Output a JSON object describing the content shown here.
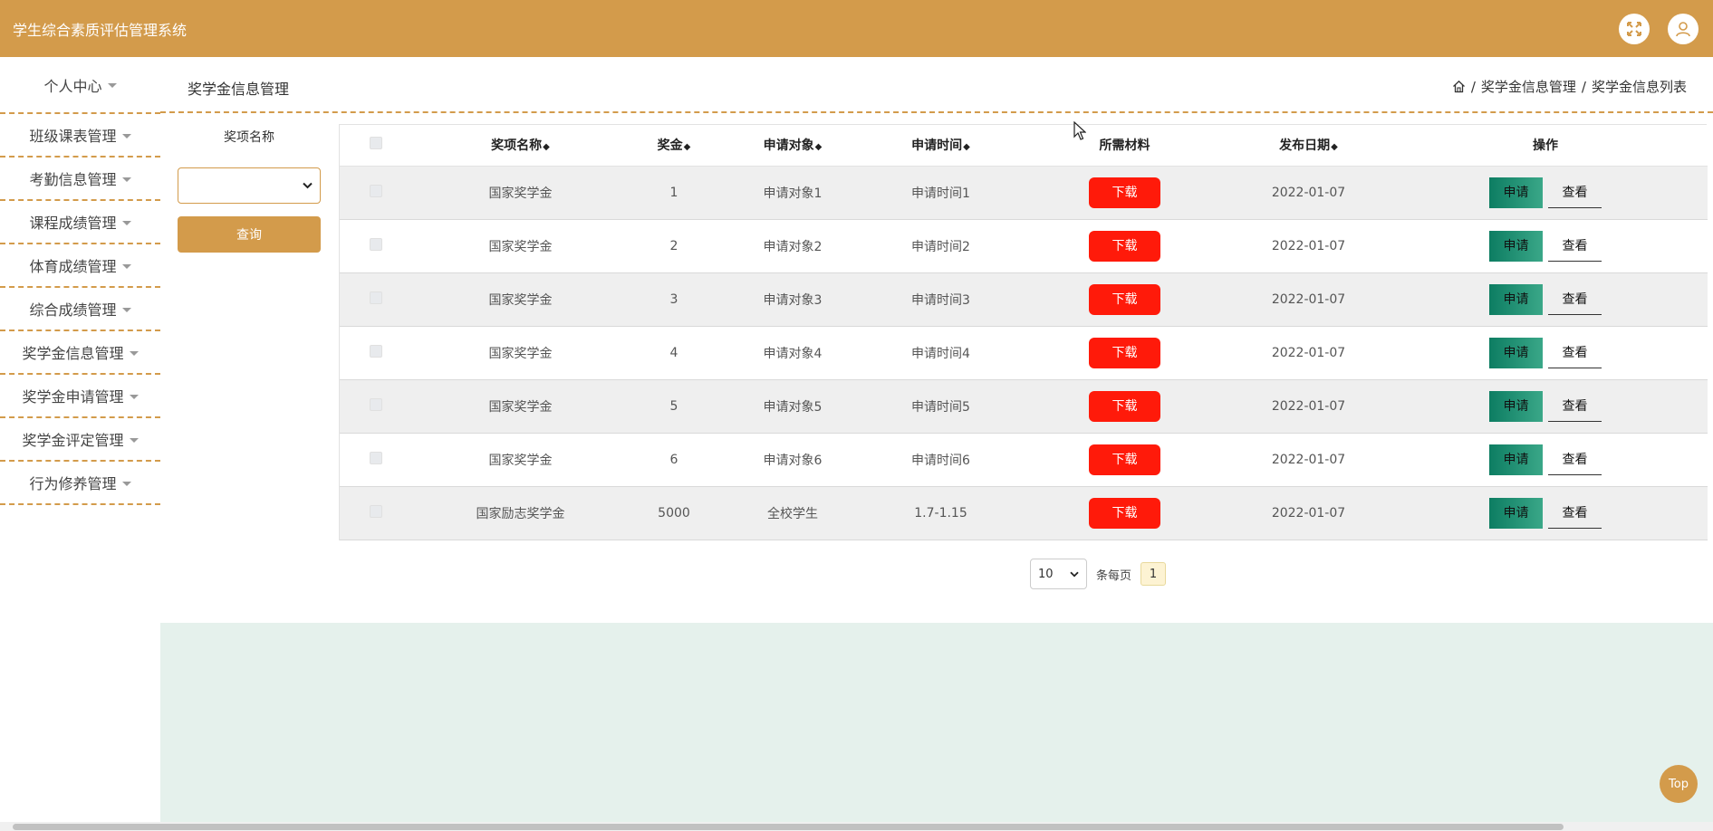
{
  "app": {
    "title": "学生综合素质评估管理系统"
  },
  "header": {
    "icons": [
      "fullscreen-icon",
      "user-icon"
    ]
  },
  "sidebar": {
    "items": [
      {
        "label": "个人中心"
      },
      {
        "label": "班级课表管理"
      },
      {
        "label": "考勤信息管理"
      },
      {
        "label": "课程成绩管理"
      },
      {
        "label": "体育成绩管理"
      },
      {
        "label": "综合成绩管理"
      },
      {
        "label": "奖学金信息管理"
      },
      {
        "label": "奖学金申请管理"
      },
      {
        "label": "奖学金评定管理"
      },
      {
        "label": "行为修养管理"
      }
    ]
  },
  "page": {
    "title": "奖学金信息管理",
    "breadcrumb": [
      "奖学金信息管理",
      "奖学金信息列表"
    ],
    "breadcrumb_sep": "/"
  },
  "search": {
    "label": "奖项名称",
    "value": "",
    "button": "查询"
  },
  "table": {
    "headers": [
      "奖项名称",
      "奖金",
      "申请对象",
      "申请时间",
      "所需材料",
      "发布日期",
      "操作"
    ],
    "sort_glyph": "◆",
    "download_label": "下载",
    "apply_label": "申请",
    "view_label": "查看",
    "rows": [
      {
        "name": "国家奖学金",
        "amount": "1",
        "target": "申请对象1",
        "time": "申请时间1",
        "date": "2022-01-07"
      },
      {
        "name": "国家奖学金",
        "amount": "2",
        "target": "申请对象2",
        "time": "申请时间2",
        "date": "2022-01-07"
      },
      {
        "name": "国家奖学金",
        "amount": "3",
        "target": "申请对象3",
        "time": "申请时间3",
        "date": "2022-01-07"
      },
      {
        "name": "国家奖学金",
        "amount": "4",
        "target": "申请对象4",
        "time": "申请时间4",
        "date": "2022-01-07"
      },
      {
        "name": "国家奖学金",
        "amount": "5",
        "target": "申请对象5",
        "time": "申请时间5",
        "date": "2022-01-07"
      },
      {
        "name": "国家奖学金",
        "amount": "6",
        "target": "申请对象6",
        "time": "申请时间6",
        "date": "2022-01-07"
      },
      {
        "name": "国家励志奖学金",
        "amount": "5000",
        "target": "全校学生",
        "time": "1.7-1.15",
        "date": "2022-01-07"
      }
    ]
  },
  "pagination": {
    "page_size": "10",
    "per_page_label": "条每页",
    "current_page": "1"
  },
  "top_button": "Top",
  "colors": {
    "accent": "#d39b4b",
    "download": "#ff1a0a",
    "apply": "#0d7d62",
    "panel": "#e5f1ec"
  }
}
